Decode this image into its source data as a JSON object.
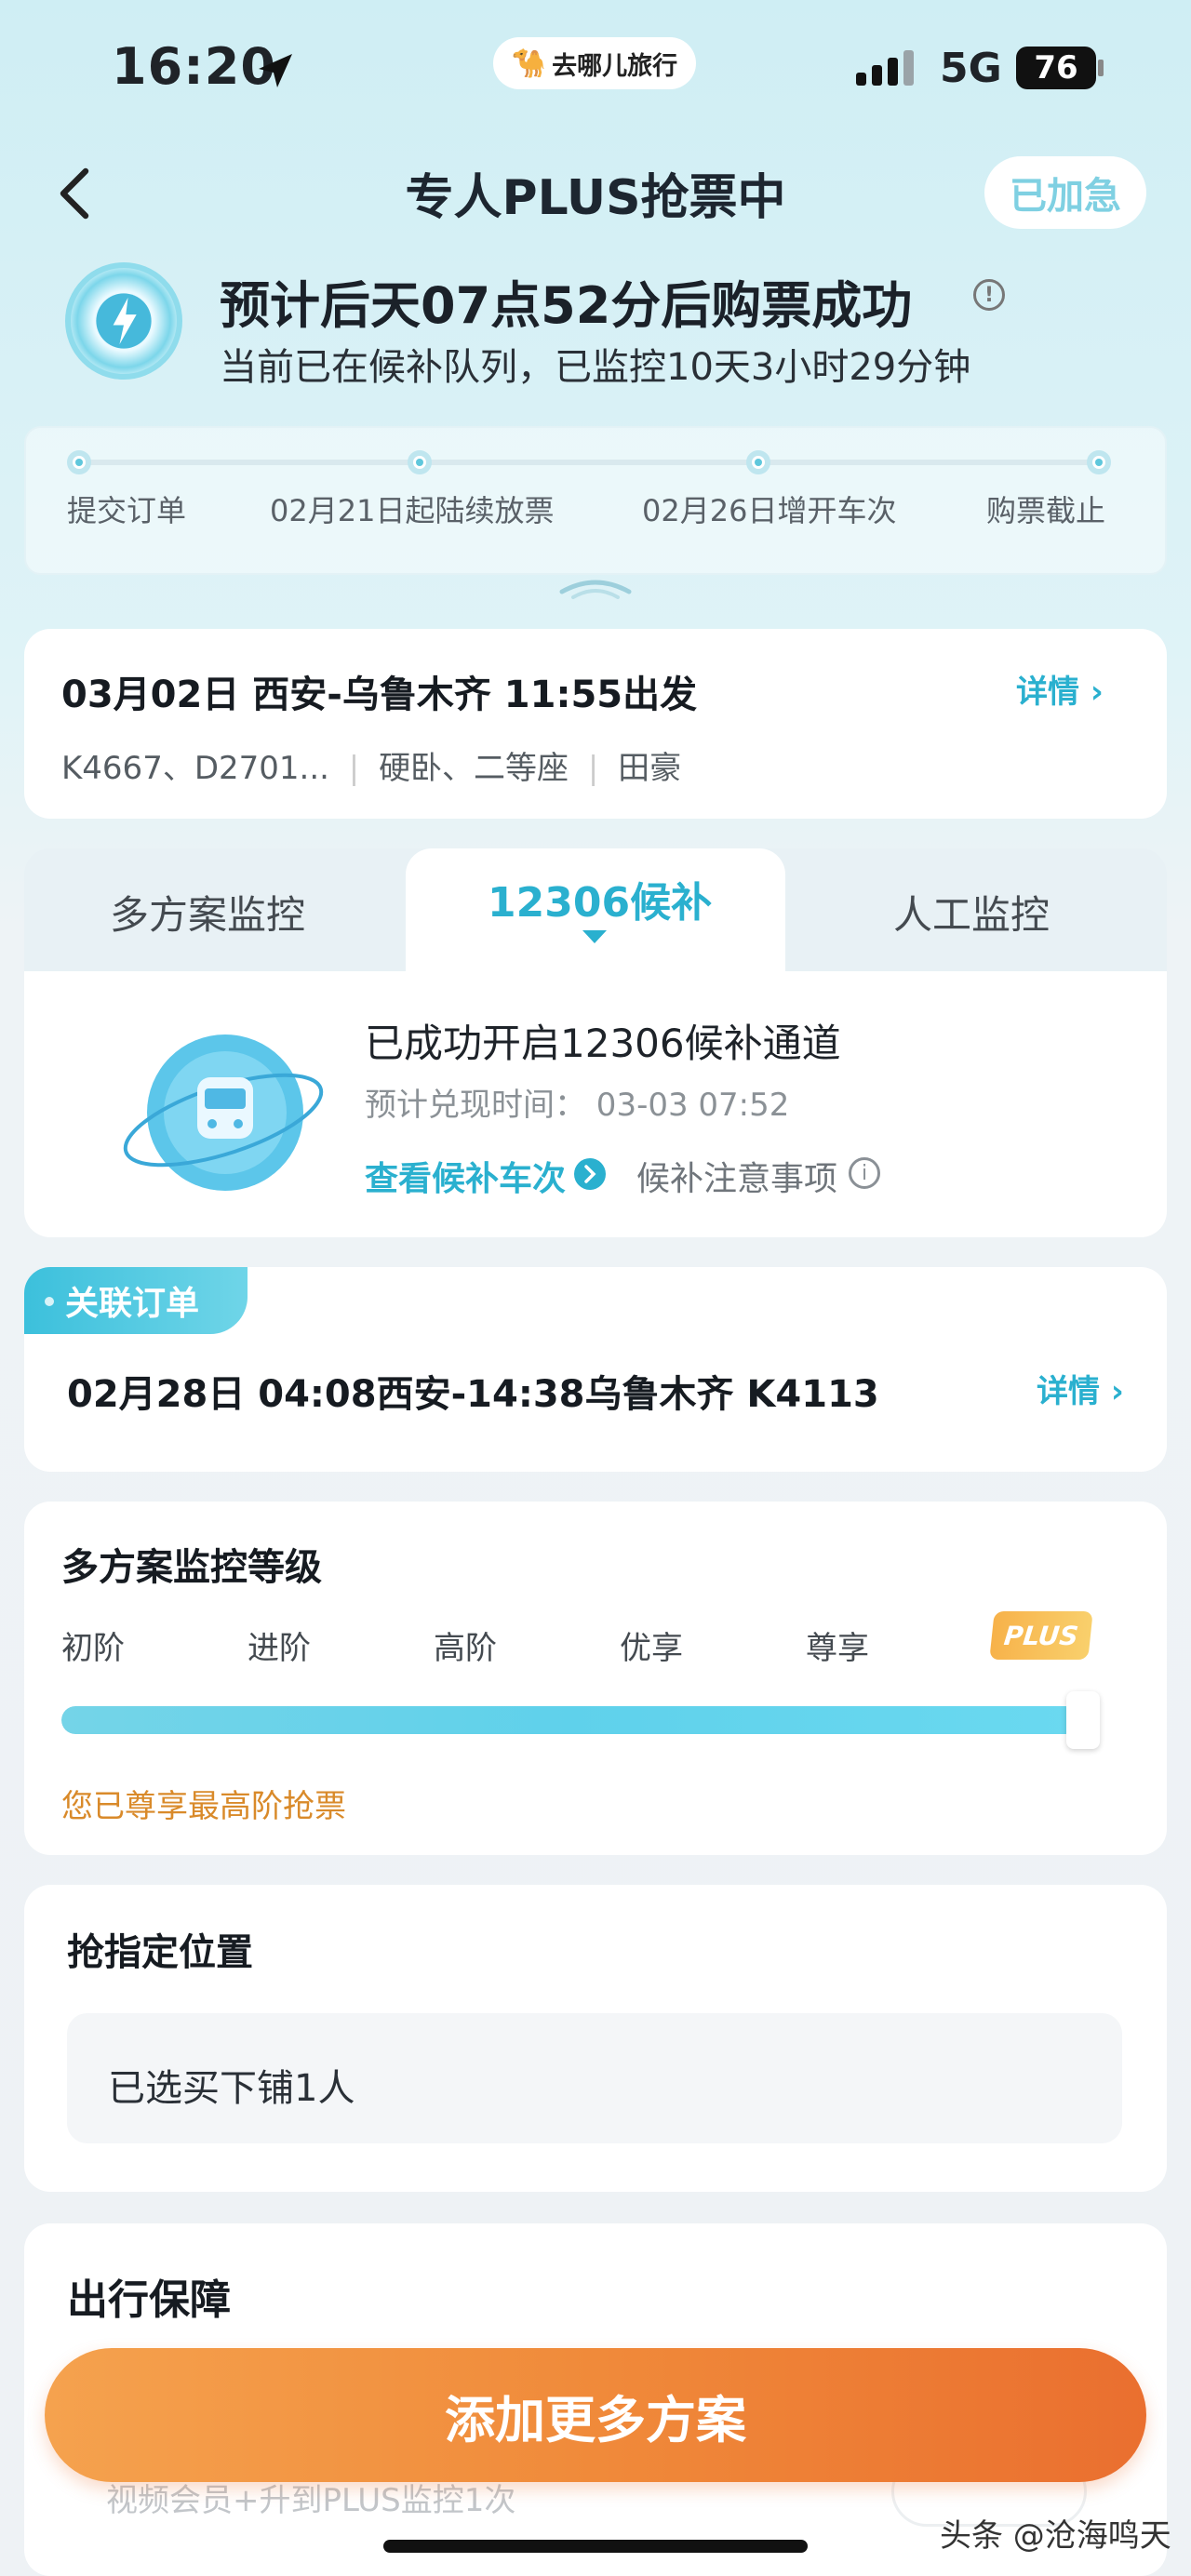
{
  "status_bar": {
    "time": "16:20",
    "network": "5G",
    "battery": "76"
  },
  "app_badge": {
    "name": "去哪儿旅行"
  },
  "nav": {
    "title": "专人PLUS抢票中",
    "urgent_label": "已加急"
  },
  "headline": {
    "title": "预计后天07点52分后购票成功",
    "subtitle": "当前已在候补队列，已监控10天3小时29分钟"
  },
  "steps": [
    "提交订单",
    "02月21日起陆续放票",
    "02月26日增开车次",
    "购票截止"
  ],
  "trip": {
    "title": "03月02日  西安-乌鲁木齐  11:55出发",
    "trains": "K4667、D2701...",
    "seats": "硬卧、二等座",
    "passenger": "田豪",
    "detail_label": "详情 ›"
  },
  "tabs": {
    "left": "多方案监控",
    "active": "12306候补",
    "right": "人工监控"
  },
  "waitlist": {
    "title": "已成功开启12306候补通道",
    "time": "预计兑现时间：  03-03 07:52",
    "view_trains": "查看候补车次",
    "notes": "候补注意事项"
  },
  "related_order": {
    "tag": "关联订单",
    "text": "02月28日 04:08西安-14:38乌鲁木齐 K4113",
    "detail_label": "详情 ›"
  },
  "monitor_level": {
    "title": "多方案监控等级",
    "levels": [
      "初阶",
      "进阶",
      "高阶",
      "优享",
      "尊享"
    ],
    "plus_badge": "PLUS",
    "progress": 1.0,
    "note": "您已尊享最高阶抢票"
  },
  "seat_pref": {
    "title": "抢指定位置",
    "value": "已选买下铺1人"
  },
  "guarantee": {
    "title": "出行保障",
    "faded_text": "视频会员+升到PLUS监控1次"
  },
  "cta": {
    "label": "添加更多方案"
  },
  "watermark": "头条 @沧海鸣天",
  "colors": {
    "accent": "#2ab0cf",
    "cta_start": "#f5a24e",
    "cta_end": "#ea6f2f",
    "note": "#d98a2a"
  }
}
